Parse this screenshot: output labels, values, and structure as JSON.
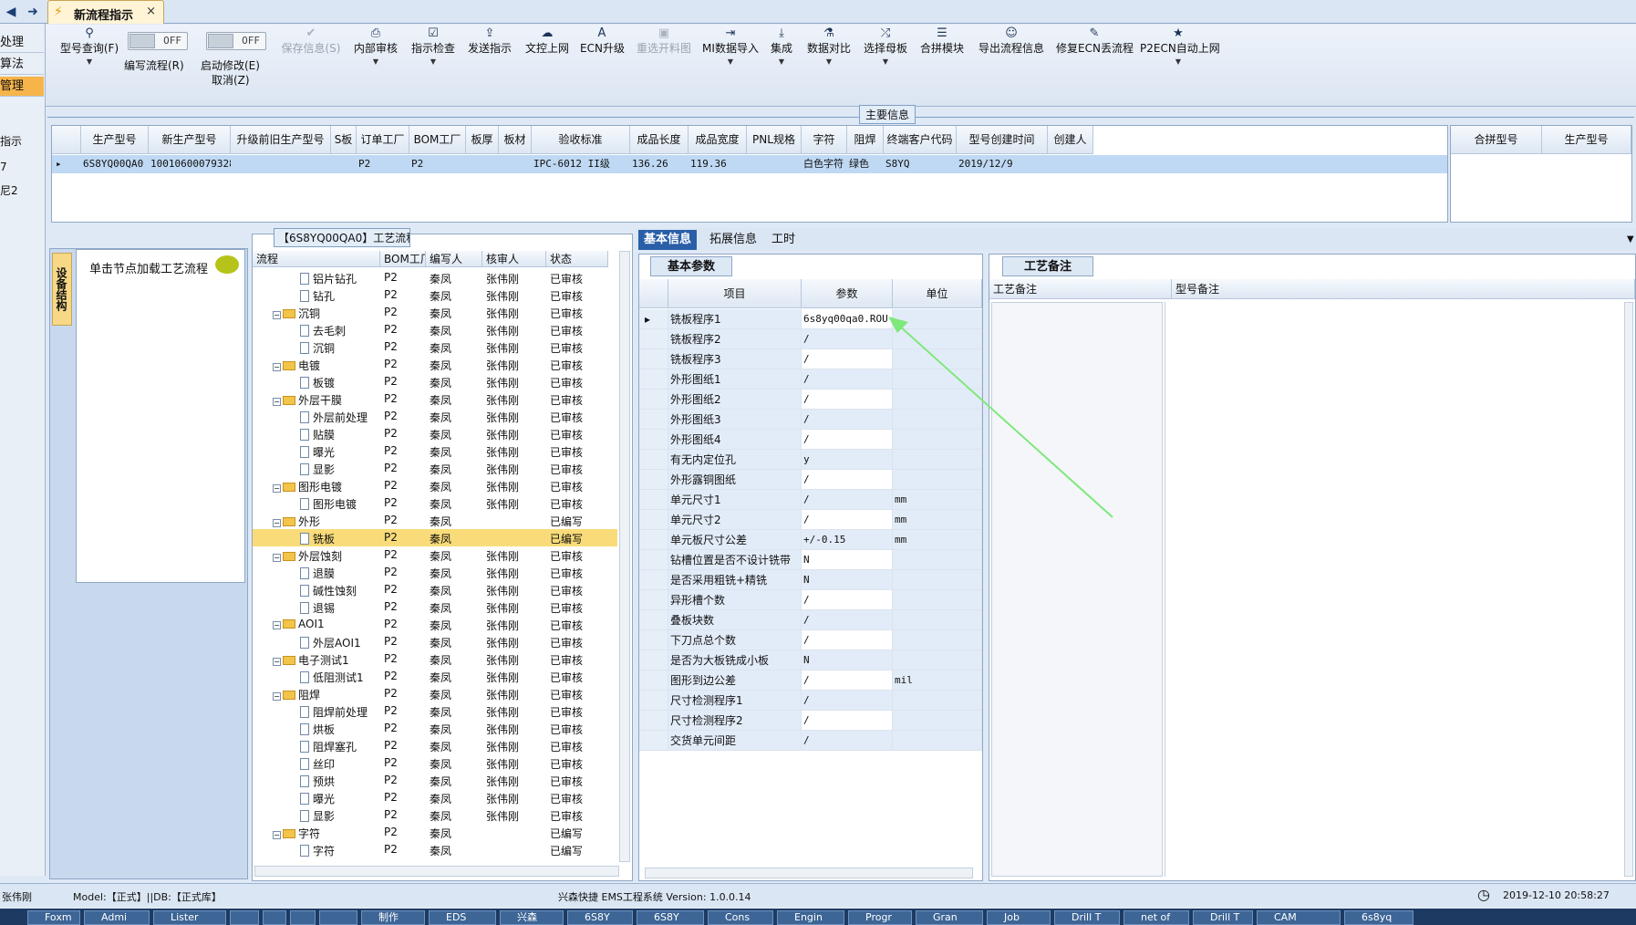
{
  "left_nav": {
    "items": [
      "处理",
      "算法",
      "管理"
    ],
    "selected_index": 2,
    "extra": [
      "指示",
      "7",
      "尼2"
    ]
  },
  "tab": {
    "title": "新流程指示",
    "close": "×"
  },
  "toolbar": {
    "query": {
      "label": "型号查询(F)"
    },
    "write_flow": {
      "label": "编写流程(R)",
      "state": "OFF"
    },
    "start_modify": {
      "label": "启动修改(E)",
      "state": "OFF",
      "cancel": "取消(Z)"
    },
    "buttons": [
      "保存信息(S)",
      "内部审核",
      "指示检查",
      "发送指示",
      "文控上网",
      "ECN升级",
      "重选开料图",
      "MI数据导入",
      "集成",
      "数据对比",
      "选择母板",
      "合拼模块",
      "导出流程信息",
      "修复ECN丢流程",
      "P2ECN自动上网"
    ]
  },
  "main_info": {
    "title": "主要信息",
    "columns": [
      "生产型号",
      "新生产型号",
      "升级前旧生产型号",
      "S板",
      "订单工厂",
      "BOM工厂",
      "板厚",
      "板材",
      "验收标准",
      "成品长度",
      "成品宽度",
      "PNL规格",
      "字符",
      "阻焊",
      "终端客户代码",
      "型号创建时间",
      "创建人"
    ],
    "row": [
      "6S8YQ00QA0",
      "10010600079328",
      "",
      "",
      "P2",
      "P2",
      "",
      "",
      "IPC-6012 II级",
      "136.26",
      "119.36",
      "",
      "白色字符",
      "绿色",
      "S8YQ",
      "2019/12/9",
      ""
    ],
    "side_columns": [
      "合拼型号",
      "生产型号"
    ]
  },
  "left_panel": {
    "vtab": "设备结构",
    "tip": "单击节点加载工艺流程"
  },
  "process": {
    "title": "【6S8YQ00QA0】工艺流程",
    "columns": [
      "流程",
      "BOM工厂",
      "编写人",
      "核审人",
      "状态"
    ],
    "rows": [
      {
        "name": "铝片钻孔",
        "level": 2,
        "bom": "P2",
        "writer": "秦凤",
        "reviewer": "张伟刚",
        "status": "已审核"
      },
      {
        "name": "钻孔",
        "level": 2,
        "bom": "P2",
        "writer": "秦凤",
        "reviewer": "张伟刚",
        "status": "已审核"
      },
      {
        "name": "沉铜",
        "level": 1,
        "bom": "P2",
        "writer": "秦凤",
        "reviewer": "张伟刚",
        "status": "已审核"
      },
      {
        "name": "去毛刺",
        "level": 2,
        "bom": "P2",
        "writer": "秦凤",
        "reviewer": "张伟刚",
        "status": "已审核"
      },
      {
        "name": "沉铜",
        "level": 2,
        "bom": "P2",
        "writer": "秦凤",
        "reviewer": "张伟刚",
        "status": "已审核"
      },
      {
        "name": "电镀",
        "level": 1,
        "bom": "P2",
        "writer": "秦凤",
        "reviewer": "张伟刚",
        "status": "已审核"
      },
      {
        "name": "板镀",
        "level": 2,
        "bom": "P2",
        "writer": "秦凤",
        "reviewer": "张伟刚",
        "status": "已审核"
      },
      {
        "name": "外层干膜",
        "level": 1,
        "bom": "P2",
        "writer": "秦凤",
        "reviewer": "张伟刚",
        "status": "已审核"
      },
      {
        "name": "外层前处理",
        "level": 2,
        "bom": "P2",
        "writer": "秦凤",
        "reviewer": "张伟刚",
        "status": "已审核"
      },
      {
        "name": "贴膜",
        "level": 2,
        "bom": "P2",
        "writer": "秦凤",
        "reviewer": "张伟刚",
        "status": "已审核"
      },
      {
        "name": "曝光",
        "level": 2,
        "bom": "P2",
        "writer": "秦凤",
        "reviewer": "张伟刚",
        "status": "已审核"
      },
      {
        "name": "显影",
        "level": 2,
        "bom": "P2",
        "writer": "秦凤",
        "reviewer": "张伟刚",
        "status": "已审核"
      },
      {
        "name": "图形电镀",
        "level": 1,
        "bom": "P2",
        "writer": "秦凤",
        "reviewer": "张伟刚",
        "status": "已审核"
      },
      {
        "name": "图形电镀",
        "level": 2,
        "bom": "P2",
        "writer": "秦凤",
        "reviewer": "张伟刚",
        "status": "已审核"
      },
      {
        "name": "外形",
        "level": 1,
        "bom": "P2",
        "writer": "秦凤",
        "reviewer": "",
        "status": "已编写"
      },
      {
        "name": "铣板",
        "level": 2,
        "bom": "P2",
        "writer": "秦凤",
        "reviewer": "",
        "status": "已编写",
        "selected": true
      },
      {
        "name": "外层蚀刻",
        "level": 1,
        "bom": "P2",
        "writer": "秦凤",
        "reviewer": "张伟刚",
        "status": "已审核"
      },
      {
        "name": "退膜",
        "level": 2,
        "bom": "P2",
        "writer": "秦凤",
        "reviewer": "张伟刚",
        "status": "已审核"
      },
      {
        "name": "碱性蚀刻",
        "level": 2,
        "bom": "P2",
        "writer": "秦凤",
        "reviewer": "张伟刚",
        "status": "已审核"
      },
      {
        "name": "退锡",
        "level": 2,
        "bom": "P2",
        "writer": "秦凤",
        "reviewer": "张伟刚",
        "status": "已审核"
      },
      {
        "name": "AOI1",
        "level": 1,
        "bom": "P2",
        "writer": "秦凤",
        "reviewer": "张伟刚",
        "status": "已审核"
      },
      {
        "name": "外层AOI1",
        "level": 2,
        "bom": "P2",
        "writer": "秦凤",
        "reviewer": "张伟刚",
        "status": "已审核"
      },
      {
        "name": "电子测试1",
        "level": 1,
        "bom": "P2",
        "writer": "秦凤",
        "reviewer": "张伟刚",
        "status": "已审核"
      },
      {
        "name": "低阻测试1",
        "level": 2,
        "bom": "P2",
        "writer": "秦凤",
        "reviewer": "张伟刚",
        "status": "已审核"
      },
      {
        "name": "阻焊",
        "level": 1,
        "bom": "P2",
        "writer": "秦凤",
        "reviewer": "张伟刚",
        "status": "已审核"
      },
      {
        "name": "阻焊前处理",
        "level": 2,
        "bom": "P2",
        "writer": "秦凤",
        "reviewer": "张伟刚",
        "status": "已审核"
      },
      {
        "name": "烘板",
        "level": 2,
        "bom": "P2",
        "writer": "秦凤",
        "reviewer": "张伟刚",
        "status": "已审核"
      },
      {
        "name": "阻焊塞孔",
        "level": 2,
        "bom": "P2",
        "writer": "秦凤",
        "reviewer": "张伟刚",
        "status": "已审核"
      },
      {
        "name": "丝印",
        "level": 2,
        "bom": "P2",
        "writer": "秦凤",
        "reviewer": "张伟刚",
        "status": "已审核"
      },
      {
        "name": "预烘",
        "level": 2,
        "bom": "P2",
        "writer": "秦凤",
        "reviewer": "张伟刚",
        "status": "已审核"
      },
      {
        "name": "曝光",
        "level": 2,
        "bom": "P2",
        "writer": "秦凤",
        "reviewer": "张伟刚",
        "status": "已审核"
      },
      {
        "name": "显影",
        "level": 2,
        "bom": "P2",
        "writer": "秦凤",
        "reviewer": "张伟刚",
        "status": "已审核"
      },
      {
        "name": "字符",
        "level": 1,
        "bom": "P2",
        "writer": "秦凤",
        "reviewer": "",
        "status": "已编写"
      },
      {
        "name": "字符",
        "level": 2,
        "bom": "P2",
        "writer": "秦凤",
        "reviewer": "",
        "status": "已编写"
      }
    ]
  },
  "mid_tabs": [
    "基本信息",
    "拓展信息",
    "工时"
  ],
  "basic": {
    "title": "基本参数",
    "columns": [
      "项目",
      "参数",
      "单位"
    ],
    "rows": [
      {
        "item": "铣板程序1",
        "value": "6s8yq00qa0.ROU",
        "unit": ""
      },
      {
        "item": "铣板程序2",
        "value": "/",
        "unit": ""
      },
      {
        "item": "铣板程序3",
        "value": "/",
        "unit": ""
      },
      {
        "item": "外形图纸1",
        "value": "/",
        "unit": ""
      },
      {
        "item": "外形图纸2",
        "value": "/",
        "unit": ""
      },
      {
        "item": "外形图纸3",
        "value": "/",
        "unit": ""
      },
      {
        "item": "外形图纸4",
        "value": "/",
        "unit": ""
      },
      {
        "item": "有无内定位孔",
        "value": "y",
        "unit": ""
      },
      {
        "item": "外形露铜图纸",
        "value": "/",
        "unit": ""
      },
      {
        "item": "单元尺寸1",
        "value": "/",
        "unit": "mm"
      },
      {
        "item": "单元尺寸2",
        "value": "/",
        "unit": "mm"
      },
      {
        "item": "单元板尺寸公差",
        "value": "+/-0.15",
        "unit": "mm"
      },
      {
        "item": "钻槽位置是否不设计铣带",
        "value": "N",
        "unit": ""
      },
      {
        "item": "是否采用粗铣+精铣",
        "value": "N",
        "unit": ""
      },
      {
        "item": "异形槽个数",
        "value": "/",
        "unit": ""
      },
      {
        "item": "叠板块数",
        "value": "/",
        "unit": ""
      },
      {
        "item": "下刀点总个数",
        "value": "/",
        "unit": ""
      },
      {
        "item": "是否为大板铣成小板",
        "value": "N",
        "unit": ""
      },
      {
        "item": "图形到边公差",
        "value": "/",
        "unit": "mil"
      },
      {
        "item": "尺寸检测程序1",
        "value": "/",
        "unit": ""
      },
      {
        "item": "尺寸检测程序2",
        "value": "/",
        "unit": ""
      },
      {
        "item": "交货单元间距",
        "value": "/",
        "unit": ""
      }
    ]
  },
  "craft": {
    "title": "工艺备注",
    "columns": [
      "工艺备注",
      "型号备注"
    ]
  },
  "status_bar": {
    "user": "张伟刚",
    "model": "Model:【正式】||DB:【正式库】",
    "system": "兴森快捷 EMS工程系统 Version: 1.0.0.14",
    "datetime": "2019-12-10 20:58:27"
  },
  "taskbar": [
    "Foxm",
    "Admi",
    "Lister",
    "",
    "",
    "",
    "",
    "制作",
    "EDS",
    "兴森",
    "6S8Y",
    "6S8Y",
    "Cons",
    "Engin",
    "Progr",
    "Gran",
    "Job",
    "Drill T",
    "net of",
    "Drill T",
    "CAM",
    "6s8yq"
  ],
  "colors": {
    "accent": "#2a5ea8",
    "selected_row": "#f9dc79",
    "annotation_arrow": "#7ee87a"
  }
}
